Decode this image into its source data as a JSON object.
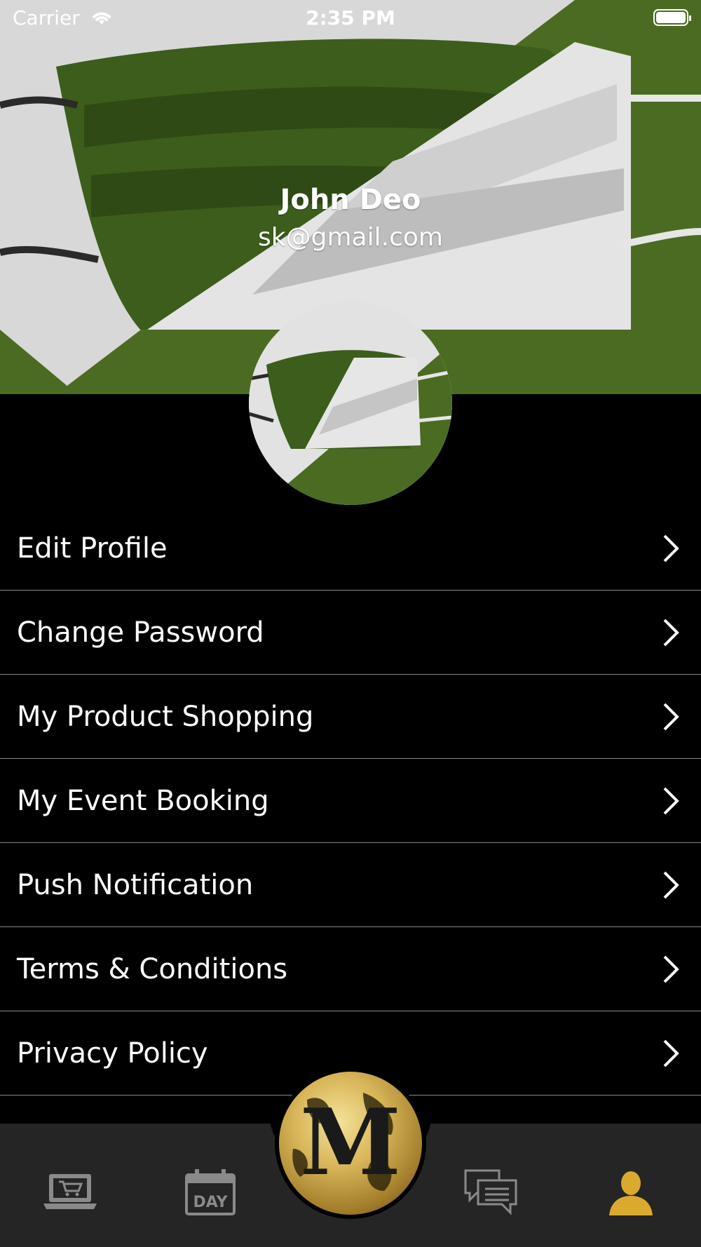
{
  "status_bar": {
    "carrier": "Carrier",
    "time": "2:35 PM"
  },
  "profile": {
    "name": "John Deo",
    "email": "sk@gmail.com"
  },
  "menu": {
    "items": [
      {
        "label": "Edit Profile"
      },
      {
        "label": "Change Password"
      },
      {
        "label": "My Product Shopping"
      },
      {
        "label": "My Event Booking"
      },
      {
        "label": "Push Notification"
      },
      {
        "label": "Terms & Conditions"
      },
      {
        "label": "Privacy Policy"
      }
    ]
  },
  "tabbar": {
    "tab_day_label": "DAY",
    "center_logo_letter": "M",
    "active_tab": "profile",
    "active_color": "#d9aa2d",
    "inactive_color": "#8a8a8a"
  },
  "colors": {
    "green": "#4b6b22",
    "background": "#000000"
  }
}
